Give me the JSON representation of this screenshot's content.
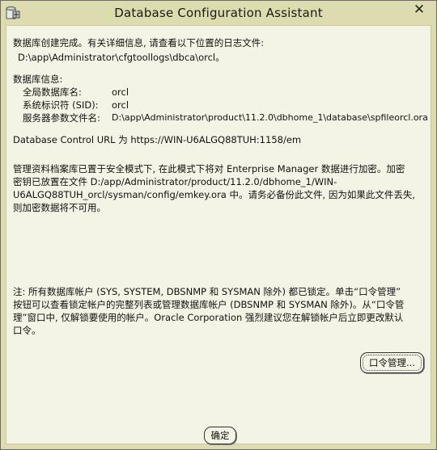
{
  "window": {
    "title": "Database Configuration Assistant",
    "close_glyph": "✕"
  },
  "intro": {
    "line1": "数据库创建完成。有关详细信息, 请查看以下位置的日志文件:",
    "log_path": "D:\\app\\Administrator\\cfgtoollogs\\dbca\\orcl。"
  },
  "db_info": {
    "heading": "数据库信息:",
    "rows": [
      {
        "label": "全局数据库名:",
        "value": "orcl"
      },
      {
        "label": "系统标识符 (SID):",
        "value": "orcl"
      },
      {
        "label": "服务器参数文件名:",
        "value": "D:\\app\\Administrator\\product\\11.2.0\\dbhome_1\\database\\spfileorcl.ora"
      }
    ]
  },
  "control_url": "Database Control URL 为 https://WIN-U6ALGQ88TUH:1158/em",
  "repository_note": {
    "lines": [
      "管理资料档案库已置于安全模式下, 在此模式下将对 Enterprise Manager 数据进行加密。加密",
      "密钥已放置在文件 D:/app/Administrator/product/11.2.0/dbhome_1/WIN-",
      "U6ALGQ88TUH_orcl/sysman/config/emkey.ora 中。请务必备份此文件, 因为如果此文件丢失,",
      "则加密数据将不可用。"
    ]
  },
  "accounts_note": {
    "lines": [
      "注: 所有数据库帐户 (SYS, SYSTEM, DBSNMP 和 SYSMAN 除外) 都已锁定。单击“口令管理”",
      "按钮可以查看锁定帐户的完整列表或管理数据库帐户 (DBSNMP 和 SYSMAN 除外)。从“口令管",
      "理”窗口中, 仅解锁要使用的帐户。Oracle Corporation 强烈建议您在解锁帐户后立即更改默认",
      "口令。"
    ]
  },
  "buttons": {
    "password_mgmt": "口令管理...",
    "ok": "确定"
  }
}
